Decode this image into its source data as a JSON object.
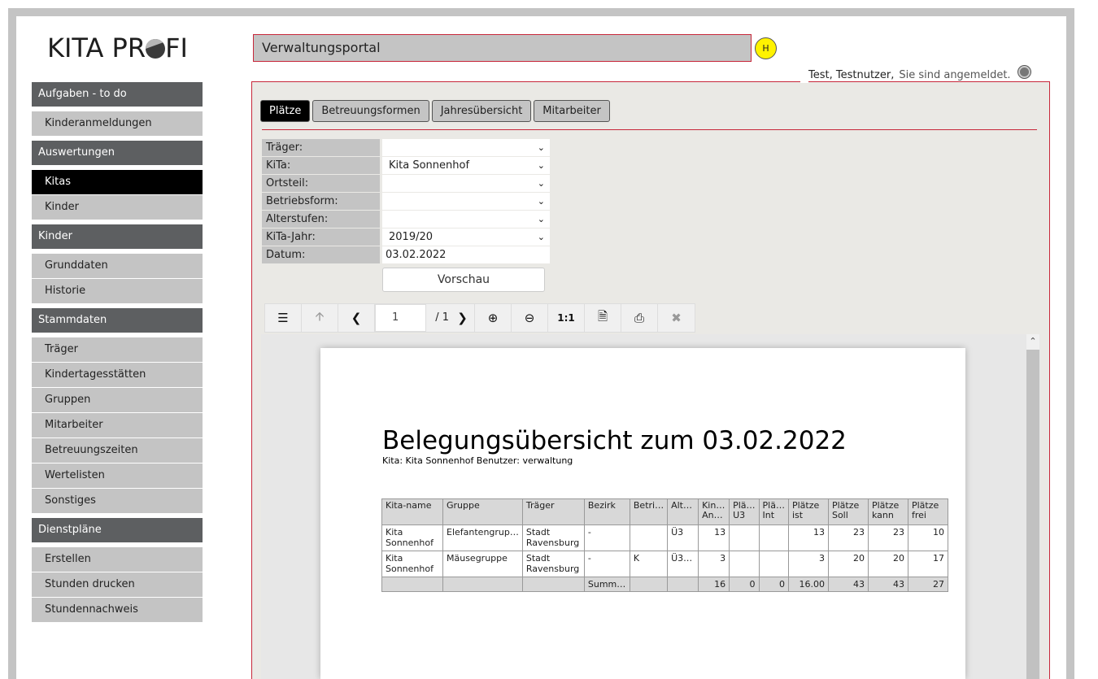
{
  "brand": {
    "logo_left": "KITA PR",
    "logo_right": "FI"
  },
  "header": {
    "portal_title": "Verwaltungsportal",
    "help_label": "H",
    "user_name": "Test, Testnutzer,",
    "login_status": "Sie sind angemeldet."
  },
  "sidebar": {
    "groups": [
      {
        "title": "Aufgaben - to do",
        "items": [
          "Kinderanmeldungen"
        ]
      },
      {
        "title": "Auswertungen",
        "items": [
          "Kitas",
          "Kinder"
        ],
        "active": "Kitas"
      },
      {
        "title": "Kinder",
        "items": [
          "Grunddaten",
          "Historie"
        ]
      },
      {
        "title": "Stammdaten",
        "items": [
          "Träger",
          "Kindertagesstätten",
          "Gruppen",
          "Mitarbeiter",
          "Betreuungszeiten",
          "Wertelisten",
          "Sonstiges"
        ]
      },
      {
        "title": "Dienstpläne",
        "items": [
          "Erstellen",
          "Stunden drucken",
          "Stundennachweis"
        ]
      }
    ]
  },
  "tabs": [
    {
      "label": "Plätze",
      "active": true
    },
    {
      "label": "Betreuungsformen",
      "active": false
    },
    {
      "label": "Jahresübersicht",
      "active": false
    },
    {
      "label": "Mitarbeiter",
      "active": false
    }
  ],
  "filters": {
    "traeger": {
      "label": "Träger:",
      "value": ""
    },
    "kita": {
      "label": "KiTa:",
      "value": "Kita Sonnenhof"
    },
    "ortsteil": {
      "label": "Ortsteil:",
      "value": ""
    },
    "betriebsform": {
      "label": "Betriebsform:",
      "value": ""
    },
    "alterstufen": {
      "label": "Alterstufen:",
      "value": ""
    },
    "kitajahr": {
      "label": "KiTa-Jahr:",
      "value": "2019/20"
    },
    "datum": {
      "label": "Datum:",
      "value": "03.02.2022"
    },
    "preview_label": "Vorschau"
  },
  "viewer": {
    "page_value": "1",
    "page_count": "/ 1",
    "zoom_reset": "1:1"
  },
  "report": {
    "title": "Belegungsübersicht zum 03.02.2022",
    "subtitle": "Kita: Kita Sonnenhof Benutzer: verwaltung",
    "headers": [
      "Kita-name",
      "Gruppe",
      "Träger",
      "Bezirk",
      "Betri…",
      "Alt…",
      "Kin… An…",
      "Plä… U3",
      "Plä… Int",
      "Plätze ist",
      "Plätze Soll",
      "Plätze kann",
      "Plätze frei"
    ],
    "rows": [
      [
        "Kita Sonnenhof",
        "Elefantengrup…",
        "Stadt Ravensburg",
        "-",
        "",
        "Ü3",
        "13",
        "",
        "",
        "13",
        "23",
        "23",
        "10"
      ],
      [
        "Kita Sonnenhof",
        "Mäusegruppe",
        "Stadt Ravensburg",
        "-",
        "K",
        "Ü3…",
        "3",
        "",
        "",
        "3",
        "20",
        "20",
        "17"
      ]
    ],
    "summary": [
      "",
      "",
      "",
      "Summ…",
      "",
      "",
      "16",
      "0",
      "0",
      "16.00",
      "43",
      "43",
      "27"
    ]
  }
}
